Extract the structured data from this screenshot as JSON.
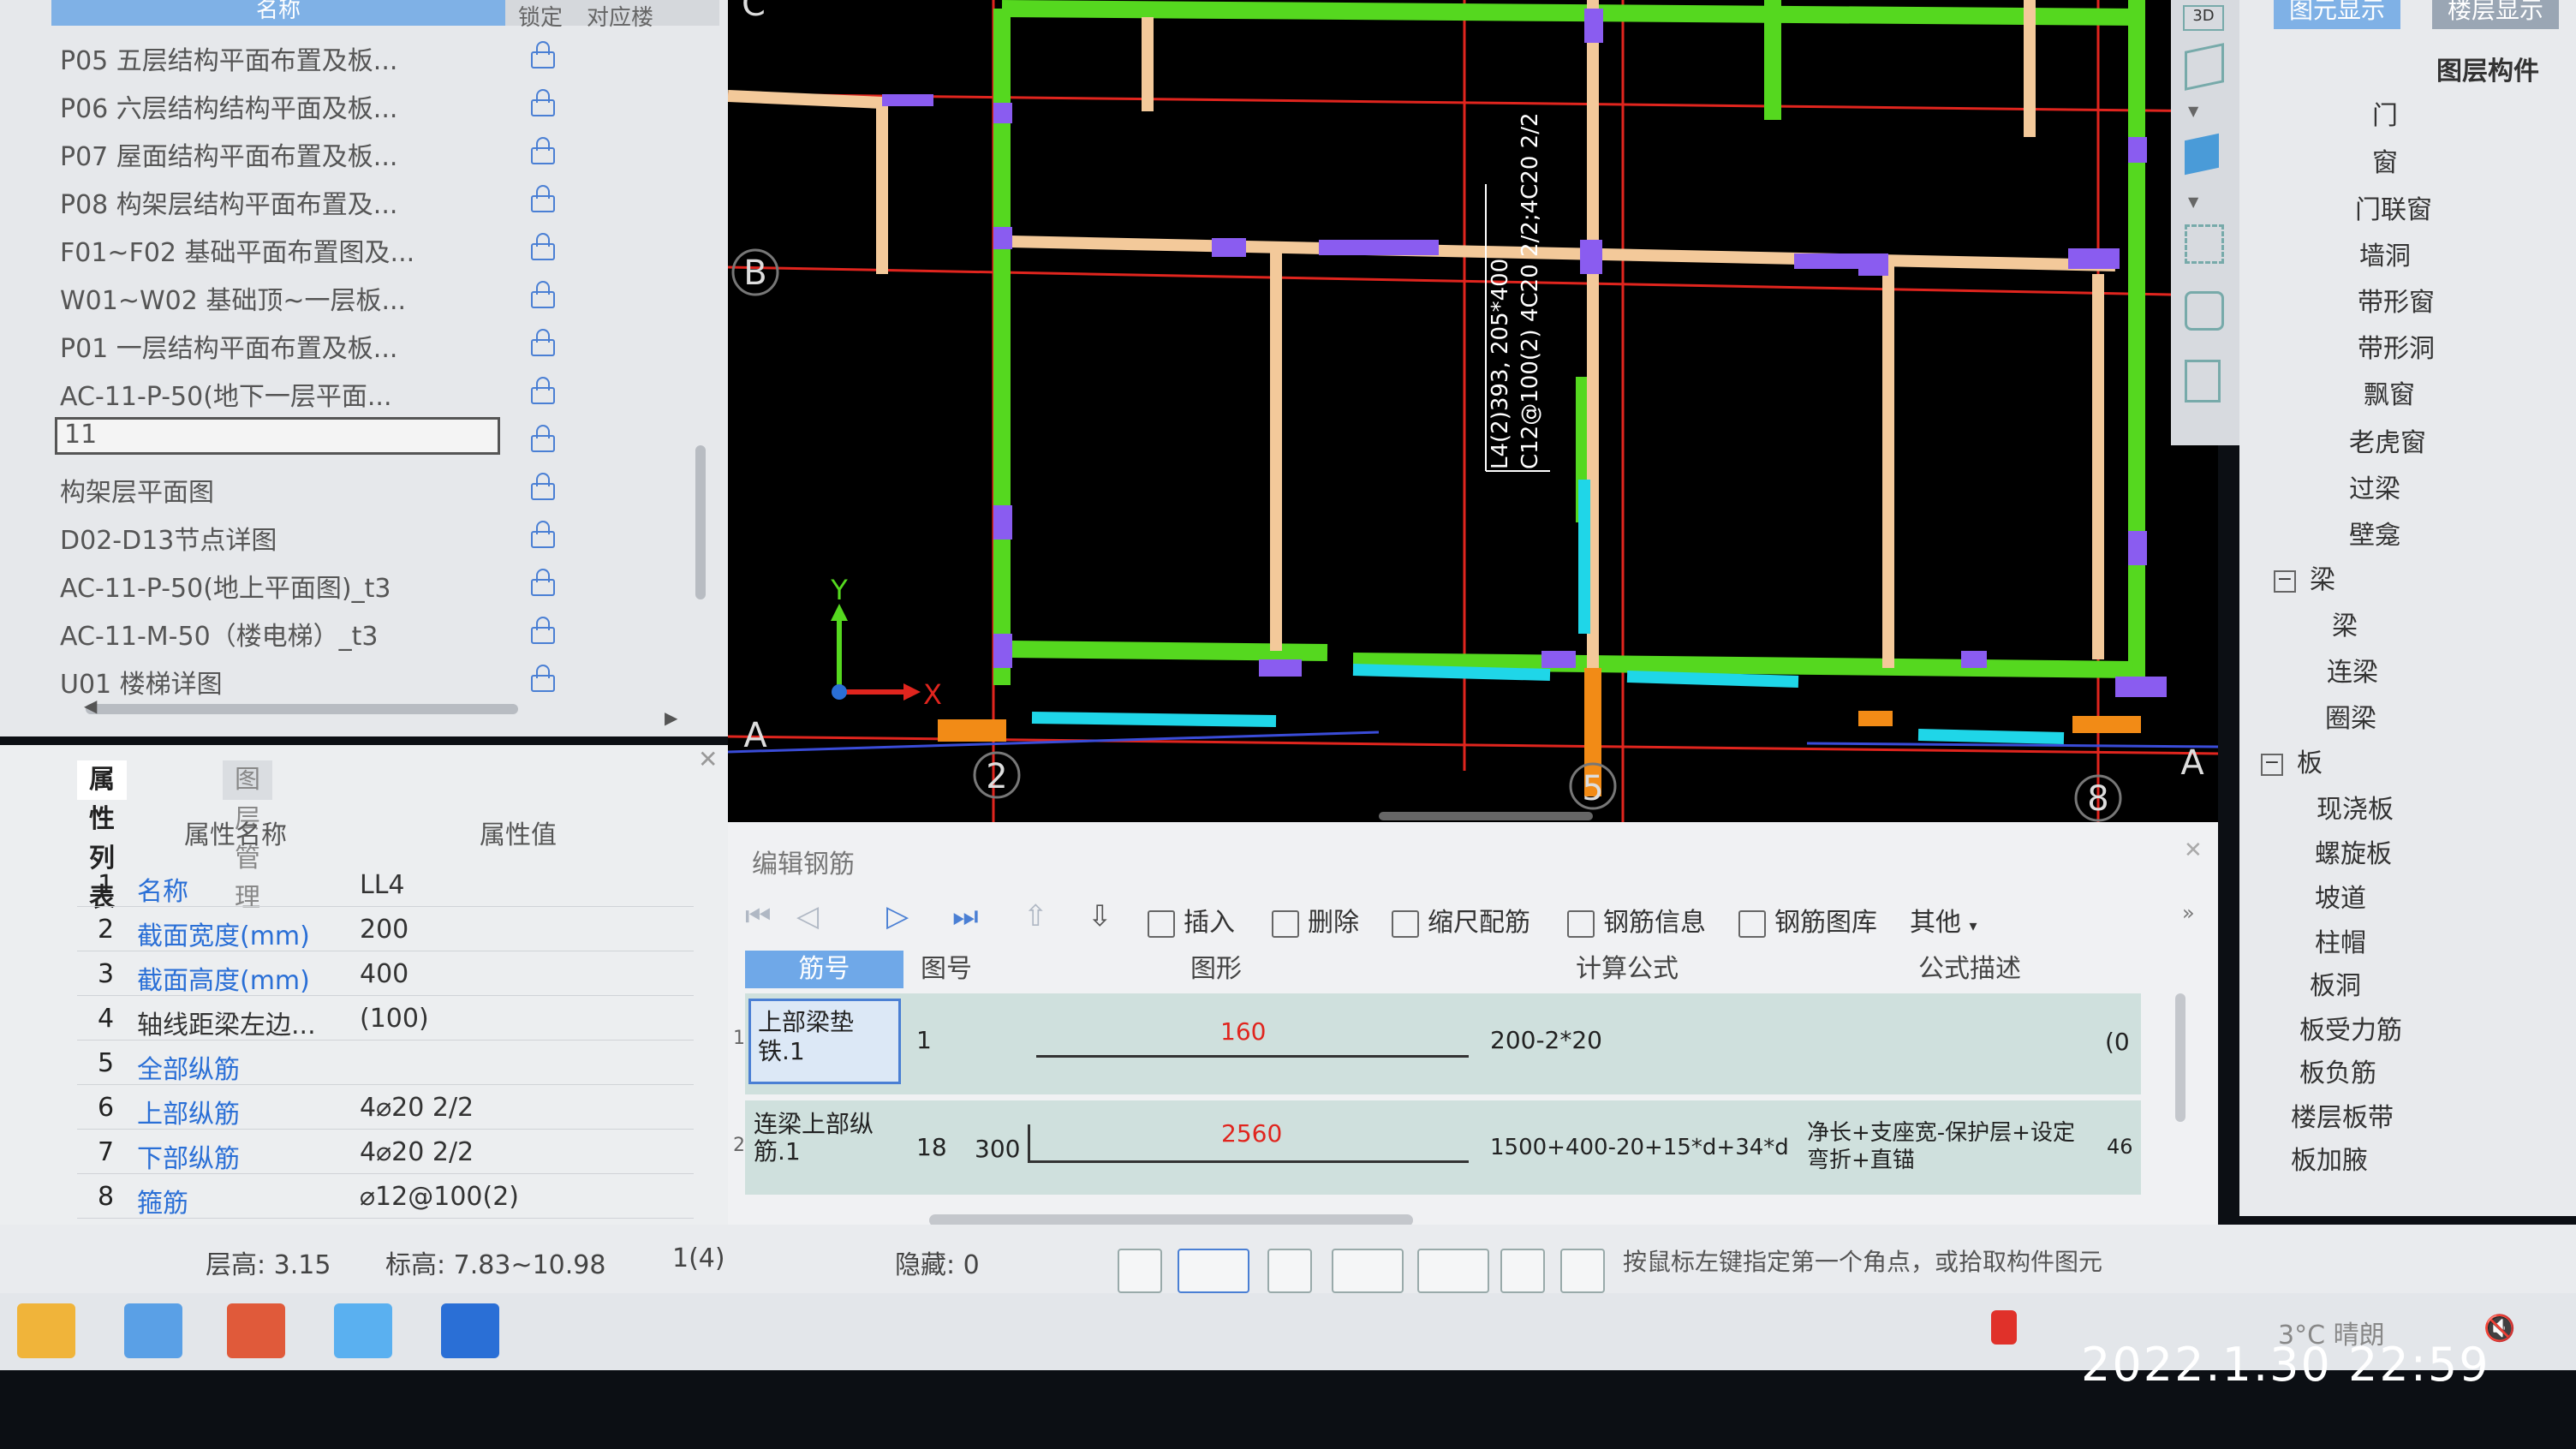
{
  "drawing_list": {
    "header": {
      "name": "名称",
      "lock": "锁定",
      "floor": "对应楼"
    },
    "items": [
      {
        "label": "P05 五层结构平面布置及板..."
      },
      {
        "label": "P06 六层结构结构平面及板..."
      },
      {
        "label": "P07 屋面结构平面布置及板..."
      },
      {
        "label": "P08 构架层结构平面布置及..."
      },
      {
        "label": "F01~F02 基础平面布置图及..."
      },
      {
        "label": "W01~W02 基础顶~一层板..."
      },
      {
        "label": "P01 一层结构平面布置及板..."
      },
      {
        "label": "AC-11-P-50(地下一层平面..."
      },
      {
        "label": "11"
      },
      {
        "label": "构架层平面图"
      },
      {
        "label": "D02-D13节点详图"
      },
      {
        "label": "AC-11-P-50(地上平面图)_t3"
      },
      {
        "label": "AC-11-M-50（楼电梯）_t3"
      },
      {
        "label": "U01 楼梯详图"
      }
    ]
  },
  "properties": {
    "tabs": {
      "attr": "属性列表",
      "layer": "图层管理"
    },
    "header": {
      "name": "属性名称",
      "value": "属性值"
    },
    "rows": [
      {
        "n": "1",
        "key": "名称",
        "value": "LL4"
      },
      {
        "n": "2",
        "key": "截面宽度(mm)",
        "value": "200"
      },
      {
        "n": "3",
        "key": "截面高度(mm)",
        "value": "400"
      },
      {
        "n": "4",
        "key": "轴线距梁左边...",
        "value": "(100)"
      },
      {
        "n": "5",
        "key": "全部纵筋",
        "value": ""
      },
      {
        "n": "6",
        "key": "上部纵筋",
        "value": "4⌀20 2/2"
      },
      {
        "n": "7",
        "key": "下部纵筋",
        "value": "4⌀20 2/2"
      },
      {
        "n": "8",
        "key": "箍筋",
        "value": "⌀12@100(2)"
      }
    ]
  },
  "status_bar": {
    "floor_height": "层高:  3.15",
    "elevation": "标高:  7.83~10.98",
    "count": "1(4)",
    "hidden": "隐藏:  0",
    "hint": "按鼠标左键指定第一个角点，或拾取构件图元"
  },
  "cad": {
    "axis_labels": {
      "b": "B",
      "a_left": "A",
      "a_right": "A",
      "c": "C",
      "n2": "2",
      "n5": "5",
      "n8": "8"
    },
    "ucs": {
      "x": "X",
      "y": "Y"
    },
    "annotation_1": "L4(2)393, 205*400",
    "annotation_2": "C12@100(2) 4C20 2/2;4C20 2/2"
  },
  "right_panel": {
    "tabs": {
      "display": "图元显示",
      "layer_display": "楼层显示"
    },
    "title": "图层构件",
    "items": [
      {
        "label": "门",
        "group": false
      },
      {
        "label": "窗",
        "group": false
      },
      {
        "label": "门联窗",
        "group": false
      },
      {
        "label": "墙洞",
        "group": false
      },
      {
        "label": "带形窗",
        "group": false
      },
      {
        "label": "带形洞",
        "group": false
      },
      {
        "label": "飘窗",
        "group": false
      },
      {
        "label": "老虎窗",
        "group": false
      },
      {
        "label": "过梁",
        "group": false
      },
      {
        "label": "壁龛",
        "group": false
      },
      {
        "label": "梁",
        "group": true
      },
      {
        "label": "梁",
        "group": false
      },
      {
        "label": "连梁",
        "group": false
      },
      {
        "label": "圈梁",
        "group": false
      },
      {
        "label": "板",
        "group": true
      },
      {
        "label": "现浇板",
        "group": false
      },
      {
        "label": "螺旋板",
        "group": false
      },
      {
        "label": "坡道",
        "group": false
      },
      {
        "label": "柱帽",
        "group": false
      },
      {
        "label": "板洞",
        "group": false
      },
      {
        "label": "板受力筋",
        "group": false
      },
      {
        "label": "板负筋",
        "group": false
      },
      {
        "label": "楼层板带",
        "group": false
      },
      {
        "label": "板加腋",
        "group": false
      }
    ]
  },
  "rebar_editor": {
    "title": "编辑钢筋",
    "toolbar": {
      "insert": "插入",
      "delete": "删除",
      "scale": "缩尺配筋",
      "info": "钢筋信息",
      "library": "钢筋图库",
      "other": "其他"
    },
    "columns": {
      "bar_no": "筋号",
      "fig_no": "图号",
      "shape": "图形",
      "formula": "计算公式",
      "desc": "公式描述"
    },
    "rows": [
      {
        "bar": "上部梁垫铁.1",
        "fig": "1",
        "left_val": "",
        "length": "160",
        "formula": "200-2*20",
        "desc": "",
        "tail": "(0"
      },
      {
        "bar": "连梁上部纵筋.1",
        "fig": "18",
        "left_val": "300",
        "length": "2560",
        "formula": "1500+400-20+15*d+34*d",
        "desc": "净长+支座宽-保护层+设定弯折+直锚",
        "tail": "46"
      }
    ],
    "row_numbers": [
      "1",
      "2"
    ]
  },
  "taskbar": {
    "weather": "3°C  晴朗",
    "datetime": "2022.1.30  22:59"
  },
  "colors": {
    "green_beam": "#55d81f",
    "purple_column": "#8a5cf0",
    "tan_wall": "#f3c99a",
    "cyan_beam": "#1fd6e8",
    "red_axis": "#e0251e",
    "accent": "#4a7fd4"
  }
}
